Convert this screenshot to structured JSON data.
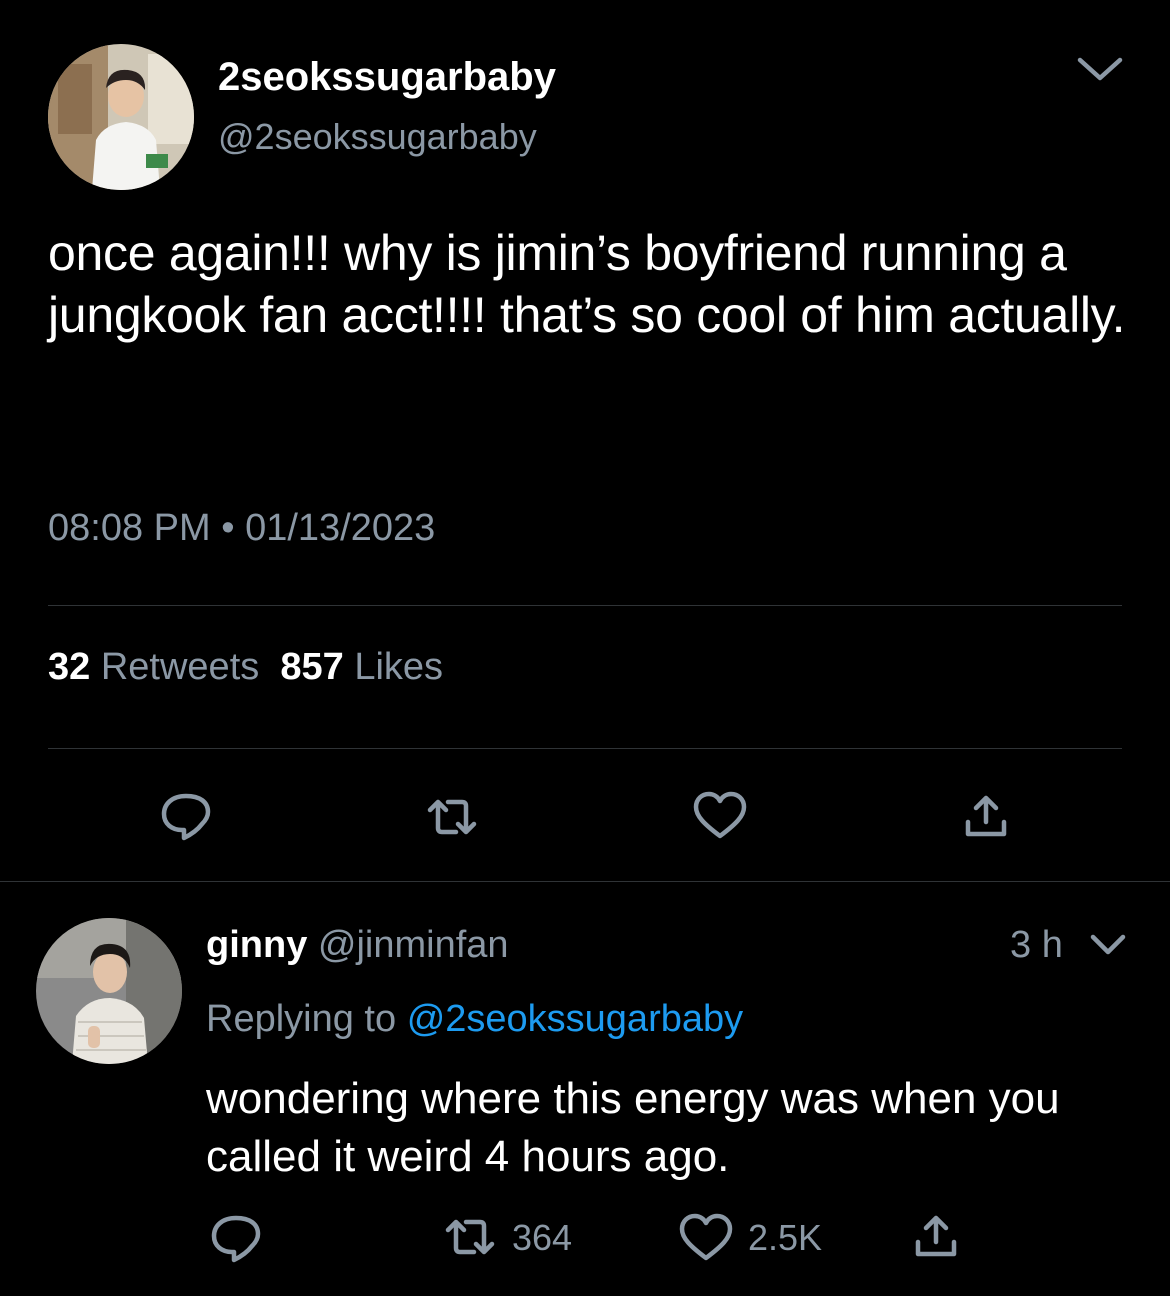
{
  "main_tweet": {
    "display_name": "2seokssugarbaby",
    "handle": "@2seokssugarbaby",
    "text": "once again!!! why is jimin’s boyfriend running a jungkook fan acct!!!! that’s so cool of him actually.",
    "timestamp": "08:08 PM • 01/13/2023",
    "retweets_count": "32",
    "retweets_label": "Retweets",
    "likes_count": "857",
    "likes_label": "Likes",
    "icons": {
      "more": "chevron-down-icon",
      "reply": "reply-icon",
      "retweet": "retweet-icon",
      "like": "heart-icon",
      "share": "share-icon"
    }
  },
  "reply_tweet": {
    "display_name": "ginny",
    "handle": "@jinminfan",
    "time_ago": "3 h",
    "replying_prefix": "Replying to",
    "replying_to": "@2seokssugarbaby",
    "text": "wondering where this energy was when you called it weird 4 hours ago.",
    "retweets_count": "364",
    "likes_count": "2.5K"
  },
  "colors": {
    "background": "#000000",
    "text_primary": "#ffffff",
    "text_secondary": "#8b98a5",
    "link": "#1d9bf0",
    "divider": "#2f3336"
  }
}
